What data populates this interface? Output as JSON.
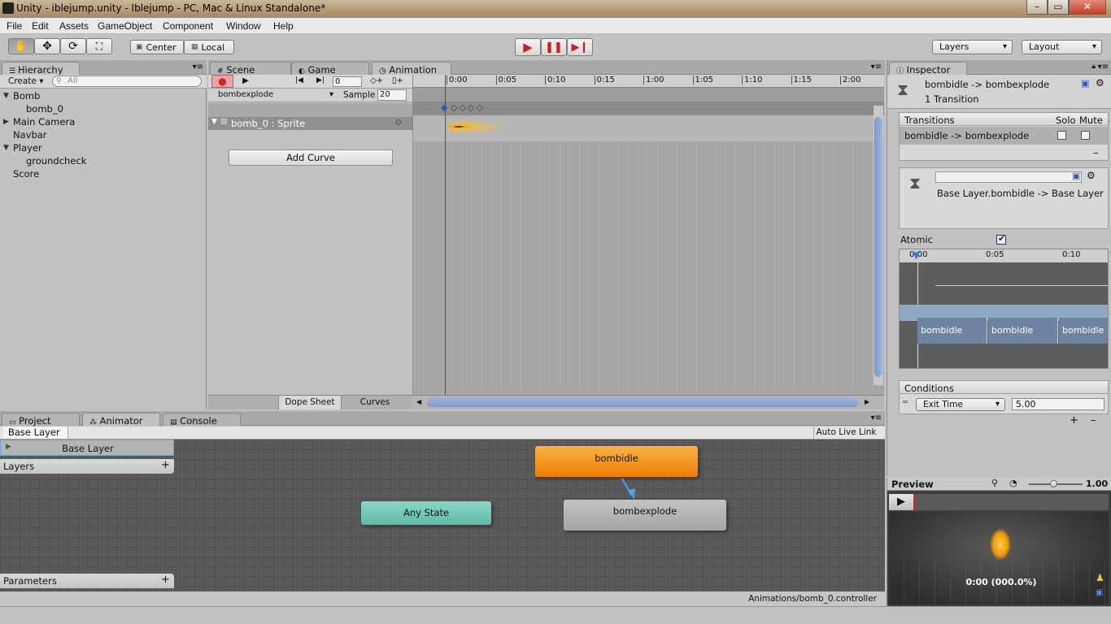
{
  "window": {
    "title": "Unity - iblejump.unity - Iblejump - PC, Mac & Linux Standalone*",
    "min": "–",
    "max": "▭",
    "close": "✕"
  },
  "menu": [
    "File",
    "Edit",
    "Assets",
    "GameObject",
    "Component",
    "Window",
    "Help"
  ],
  "toolbar": {
    "center_label": "Center",
    "local_label": "Local",
    "layers_label": "Layers",
    "layout_label": "Layout"
  },
  "hierarchy": {
    "tab": "Hierarchy",
    "create_label": "Create",
    "search_placeholder": "All",
    "items": [
      {
        "label": "Bomb",
        "arrow": "▼",
        "indent": 0
      },
      {
        "label": "bomb_0",
        "arrow": "",
        "indent": 1
      },
      {
        "label": "Main Camera",
        "arrow": "▶",
        "indent": 0
      },
      {
        "label": "Navbar",
        "arrow": "",
        "indent": 0
      },
      {
        "label": "Player",
        "arrow": "▼",
        "indent": 0
      },
      {
        "label": "groundcheck",
        "arrow": "",
        "indent": 1
      },
      {
        "label": "Score",
        "arrow": "",
        "indent": 0
      }
    ]
  },
  "center_tabs": {
    "scene": "Scene",
    "game": "Game",
    "animation": "Animation"
  },
  "animation": {
    "frame_value": "0",
    "clip_name": "bombexplode",
    "sample_label": "Sample",
    "sample_value": "20",
    "property_label": "bomb_0 : Sprite",
    "add_curve_label": "Add Curve",
    "dope_sheet_label": "Dope Sheet",
    "curves_label": "Curves",
    "ruler": [
      "0:00",
      "0:05",
      "0:10",
      "0:15",
      "1:00",
      "1:05",
      "1:10",
      "1:15",
      "2:00"
    ]
  },
  "bottom_tabs": {
    "project": "Project",
    "animator": "Animator",
    "console": "Console"
  },
  "animator": {
    "breadcrumb": "Base Layer",
    "auto_live_link": "Auto Live Link",
    "layer_name": "Base Layer",
    "layers_label": "Layers",
    "parameters_label": "Parameters",
    "state_default": "bombidle",
    "state_other": "bombexplode",
    "any_state": "Any State",
    "status_path": "Animations/bomb_0.controller",
    "default_color": "#f08a00",
    "any_color": "#6cc7b6"
  },
  "inspector": {
    "tab": "Inspector",
    "title": "bombidle -> bombexplode",
    "subtitle": "1 Transition",
    "transitions_header": "Transitions",
    "solo_label": "Solo",
    "mute_label": "Mute",
    "transition_row": "bombidle -> bombexplode",
    "transition_path": "Base Layer.bombidle -> Base Layer",
    "atomic_label": "Atomic",
    "timeline_ticks": [
      "0:00",
      "0:05",
      "0:10"
    ],
    "timeline_blocks": [
      "bombidle",
      "bombidle",
      "bombidle"
    ],
    "conditions_label": "Conditions",
    "condition_param": "Exit Time",
    "condition_value": "5.00",
    "plus": "+",
    "minus": "–"
  },
  "preview": {
    "label": "Preview",
    "speed": "1.00",
    "time_readout": "0:00 (000.0%)"
  }
}
